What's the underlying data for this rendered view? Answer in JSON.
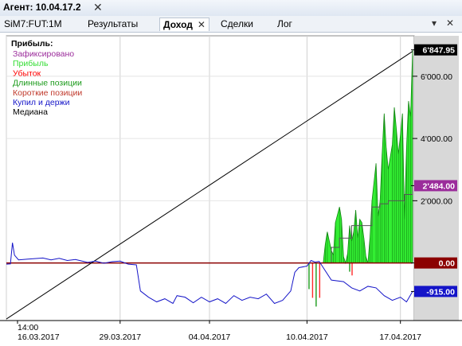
{
  "window": {
    "title": "Агент: 10.04.17.2"
  },
  "tabs": [
    {
      "label": "SiM7:FUT:1M"
    },
    {
      "label": "Результаты"
    },
    {
      "label": "Доход",
      "active": true
    },
    {
      "label": "Сделки"
    },
    {
      "label": "Лог"
    }
  ],
  "legend": {
    "title": "Прибыль:",
    "items": [
      {
        "label": "Зафиксировано",
        "color": "#9b2c9b"
      },
      {
        "label": "Прибыль",
        "color": "#33dd33"
      },
      {
        "label": "Убыток",
        "color": "#ff0000"
      },
      {
        "label": "Длинные позиции",
        "color": "#1a9a1a"
      },
      {
        "label": "Короткие позиции",
        "color": "#c0392b"
      },
      {
        "label": "Купил и держи",
        "color": "#1414c8"
      },
      {
        "label": "Медиана",
        "color": "#000000"
      }
    ]
  },
  "value_badges": [
    {
      "label": "6'847.95",
      "value": 6847.95,
      "bg": "#000000",
      "fg": "#ffffff"
    },
    {
      "label": "2'484.00",
      "value": 2484.0,
      "bg": "#9b2c9b",
      "fg": "#ffffff"
    },
    {
      "label": "0.00",
      "value": 0,
      "bg": "#8b0000",
      "fg": "#ffffff"
    },
    {
      "label": "-915.00",
      "value": -915.0,
      "bg": "#1414c8",
      "fg": "#ffffff"
    }
  ],
  "chart_data": {
    "type": "area",
    "ylim": [
      -1850,
      7300
    ],
    "y_ticks": [
      {
        "label": "6'000.00",
        "value": 6000
      },
      {
        "label": "4'000.00",
        "value": 4000
      },
      {
        "label": "2'000.00",
        "value": 2000
      }
    ],
    "x_labels": [
      {
        "label": "14:00",
        "at": 0.0
      },
      {
        "label": "16.03.2017",
        "at": 0.0
      },
      {
        "label": "29.03.2017",
        "at": 0.28
      },
      {
        "label": "04.04.2017",
        "at": 0.5
      },
      {
        "label": "10.04.2017",
        "at": 0.74
      },
      {
        "label": "17.04.2017",
        "at": 0.97
      }
    ],
    "median_line": {
      "from": [
        0.0,
        -1800
      ],
      "to": [
        1.0,
        6800
      ]
    },
    "buy_and_hold": [
      [
        0.0,
        -40
      ],
      [
        0.01,
        -30
      ],
      [
        0.015,
        650
      ],
      [
        0.02,
        250
      ],
      [
        0.03,
        100
      ],
      [
        0.05,
        120
      ],
      [
        0.07,
        140
      ],
      [
        0.09,
        160
      ],
      [
        0.11,
        100
      ],
      [
        0.13,
        150
      ],
      [
        0.15,
        80
      ],
      [
        0.17,
        110
      ],
      [
        0.2,
        20
      ],
      [
        0.22,
        60
      ],
      [
        0.24,
        -10
      ],
      [
        0.26,
        40
      ],
      [
        0.28,
        60
      ],
      [
        0.3,
        -40
      ],
      [
        0.32,
        -60
      ],
      [
        0.33,
        -900
      ],
      [
        0.35,
        -1100
      ],
      [
        0.37,
        -1250
      ],
      [
        0.39,
        -1150
      ],
      [
        0.41,
        -1300
      ],
      [
        0.42,
        -1050
      ],
      [
        0.44,
        -1100
      ],
      [
        0.46,
        -1280
      ],
      [
        0.48,
        -1100
      ],
      [
        0.5,
        -1250
      ],
      [
        0.52,
        -1150
      ],
      [
        0.54,
        -1300
      ],
      [
        0.56,
        -1050
      ],
      [
        0.58,
        -1200
      ],
      [
        0.6,
        -1100
      ],
      [
        0.62,
        -1150
      ],
      [
        0.64,
        -1000
      ],
      [
        0.66,
        -1300
      ],
      [
        0.68,
        -1200
      ],
      [
        0.7,
        -900
      ],
      [
        0.71,
        -300
      ],
      [
        0.72,
        -150
      ],
      [
        0.74,
        -100
      ],
      [
        0.75,
        80
      ],
      [
        0.76,
        30
      ],
      [
        0.77,
        50
      ],
      [
        0.8,
        -550
      ],
      [
        0.83,
        -600
      ],
      [
        0.85,
        -800
      ],
      [
        0.87,
        -900
      ],
      [
        0.89,
        -750
      ],
      [
        0.91,
        -800
      ],
      [
        0.93,
        -1050
      ],
      [
        0.95,
        -1200
      ],
      [
        0.97,
        -1100
      ],
      [
        0.985,
        -1250
      ],
      [
        1.0,
        -915
      ]
    ],
    "long_profit": [
      [
        0.775,
        0
      ],
      [
        0.78,
        -200
      ],
      [
        0.785,
        600
      ],
      [
        0.79,
        1000
      ],
      [
        0.8,
        400
      ],
      [
        0.805,
        250
      ],
      [
        0.81,
        1300
      ],
      [
        0.82,
        1800
      ],
      [
        0.825,
        1400
      ],
      [
        0.83,
        200
      ],
      [
        0.835,
        0
      ],
      [
        0.84,
        300
      ],
      [
        0.845,
        1200
      ],
      [
        0.85,
        700
      ],
      [
        0.855,
        1000
      ],
      [
        0.86,
        1700
      ],
      [
        0.865,
        800
      ],
      [
        0.87,
        1400
      ],
      [
        0.875,
        1300
      ],
      [
        0.88,
        800
      ],
      [
        0.885,
        200
      ],
      [
        0.89,
        0
      ],
      [
        0.895,
        800
      ],
      [
        0.9,
        2000
      ],
      [
        0.91,
        3200
      ],
      [
        0.915,
        1500
      ],
      [
        0.92,
        2000
      ],
      [
        0.925,
        3500
      ],
      [
        0.93,
        4800
      ],
      [
        0.935,
        3700
      ],
      [
        0.94,
        3000
      ],
      [
        0.95,
        3800
      ],
      [
        0.955,
        5000
      ],
      [
        0.96,
        4300
      ],
      [
        0.965,
        3500
      ],
      [
        0.97,
        4100
      ],
      [
        0.975,
        4800
      ],
      [
        0.98,
        1400
      ],
      [
        0.985,
        3700
      ],
      [
        0.99,
        5200
      ],
      [
        0.995,
        4700
      ],
      [
        1.0,
        6850
      ]
    ],
    "short_losses": [
      {
        "x": 0.745,
        "w": 0.035,
        "min": -1400
      },
      {
        "x": 0.845,
        "w": 0.012,
        "min": -400
      }
    ],
    "fixed_profit": [
      [
        0.79,
        0
      ],
      [
        0.8,
        500
      ],
      [
        0.82,
        800
      ],
      [
        0.84,
        800
      ],
      [
        0.85,
        1200
      ],
      [
        0.88,
        1200
      ],
      [
        0.9,
        1800
      ],
      [
        0.92,
        1900
      ],
      [
        0.94,
        2000
      ],
      [
        0.96,
        2000
      ],
      [
        0.98,
        2200
      ],
      [
        1.0,
        2484
      ]
    ]
  }
}
